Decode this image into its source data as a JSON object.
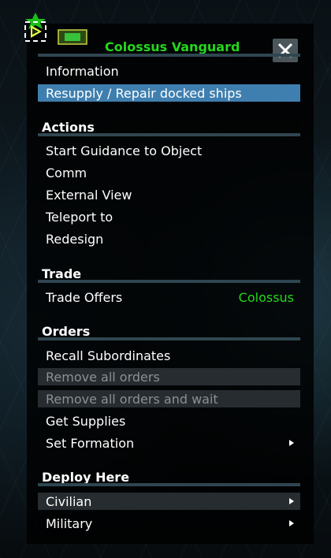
{
  "menu": {
    "title": "Colossus Vanguard",
    "close_icon": "close-icon",
    "top_items": [
      {
        "label": "Information"
      },
      {
        "label": "Resupply / Repair docked ships"
      }
    ],
    "sections": {
      "actions": {
        "header": "Actions",
        "items": [
          {
            "label": "Start Guidance to Object"
          },
          {
            "label": "Comm"
          },
          {
            "label": "External View"
          },
          {
            "label": "Teleport to"
          },
          {
            "label": "Redesign"
          }
        ]
      },
      "trade": {
        "header": "Trade",
        "items": [
          {
            "label": "Trade Offers",
            "value": "Colossus"
          }
        ]
      },
      "orders": {
        "header": "Orders",
        "items": [
          {
            "label": "Recall Subordinates"
          },
          {
            "label": "Remove all orders"
          },
          {
            "label": "Remove all orders and wait"
          },
          {
            "label": "Get Supplies"
          },
          {
            "label": "Set Formation"
          }
        ]
      },
      "deploy": {
        "header": "Deploy Here",
        "items": [
          {
            "label": "Civilian"
          },
          {
            "label": "Military"
          }
        ]
      }
    }
  },
  "colors": {
    "accent_green": "#23d81b",
    "highlight_blue": "#3f7faf",
    "separator": "#2f4650"
  }
}
